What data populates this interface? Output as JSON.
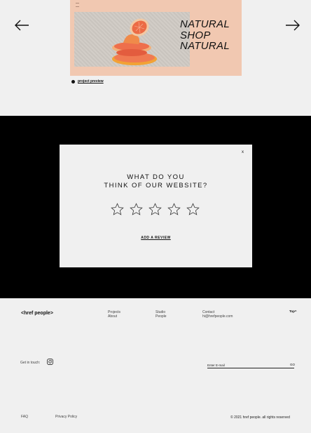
{
  "project": {
    "card_title_lines": [
      "NATURAL",
      "SHOP",
      "NATURAL"
    ],
    "preview_label": "project preview",
    "card_color": "#f1c8b1"
  },
  "nav": {
    "prev_icon": "arrow-left",
    "next_icon": "arrow-right"
  },
  "modal": {
    "close_label": "x",
    "question_line1": "WHAT DO YOU",
    "question_line2": "THINK OF OUR WEBSITE?",
    "star_count": 5,
    "add_review_label": "ADD A REVIEW"
  },
  "footer": {
    "brand": "<href people>",
    "col1": [
      "Projects",
      "About"
    ],
    "col2": [
      "Studio",
      "People"
    ],
    "col3": [
      "Contact",
      "hi@hrefpeople.com"
    ],
    "top_label": "Top^",
    "get_in_touch": "Get in touch:",
    "email_placeholder": "Enter E-mail",
    "go_label": "GO",
    "faq": "FAQ",
    "privacy": "Privacy Policy",
    "copyright": "© 2021 href people. all rights reserved"
  }
}
